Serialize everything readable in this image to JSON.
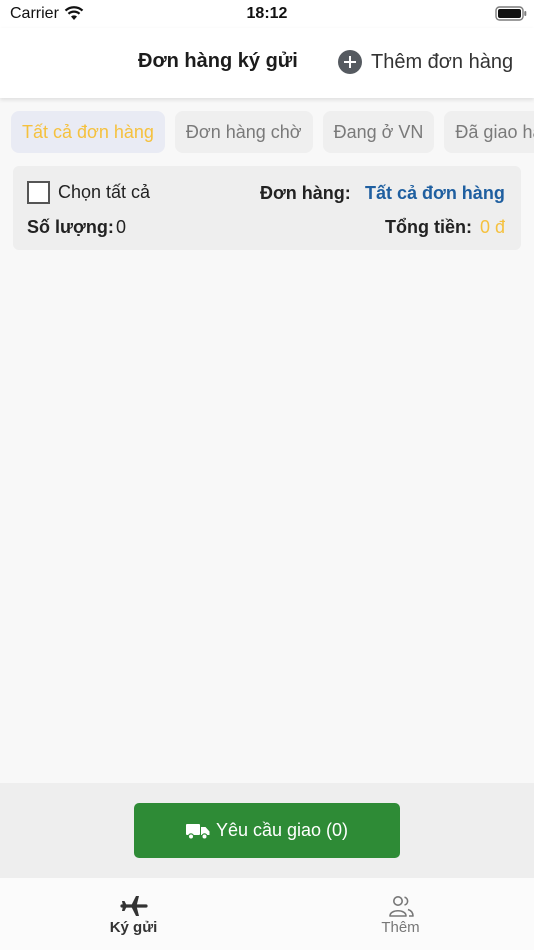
{
  "status_bar": {
    "carrier": "Carrier",
    "time": "18:12"
  },
  "header": {
    "title": "Đơn hàng ký gửi",
    "add_order_label": "Thêm đơn hàng"
  },
  "filter_tabs": [
    {
      "label": "Tất cả đơn hàng",
      "active": true
    },
    {
      "label": "Đơn hàng chờ",
      "active": false
    },
    {
      "label": "Đang ở VN",
      "active": false
    },
    {
      "label": "Đã giao hàng",
      "active": false
    }
  ],
  "summary": {
    "select_all_label": "Chọn tất cả",
    "select_all_checked": false,
    "order_label": "Đơn hàng:",
    "order_value": "Tất cả đơn hàng",
    "quantity_label": "Số lượng:",
    "quantity_value": "0",
    "total_label": "Tổng tiền:",
    "total_value": "0 đ"
  },
  "delivery_request": {
    "label": "Yêu cầu giao (0)",
    "icon": "truck-icon"
  },
  "bottom_tabs": [
    {
      "label": "Ký gửi",
      "icon": "airplane-icon",
      "active": true
    },
    {
      "label": "Thêm",
      "icon": "people-icon",
      "active": false
    }
  ],
  "colors": {
    "accent_yellow": "#f5c13e",
    "link_blue": "#1f5fa0",
    "button_green": "#2e8b36"
  }
}
